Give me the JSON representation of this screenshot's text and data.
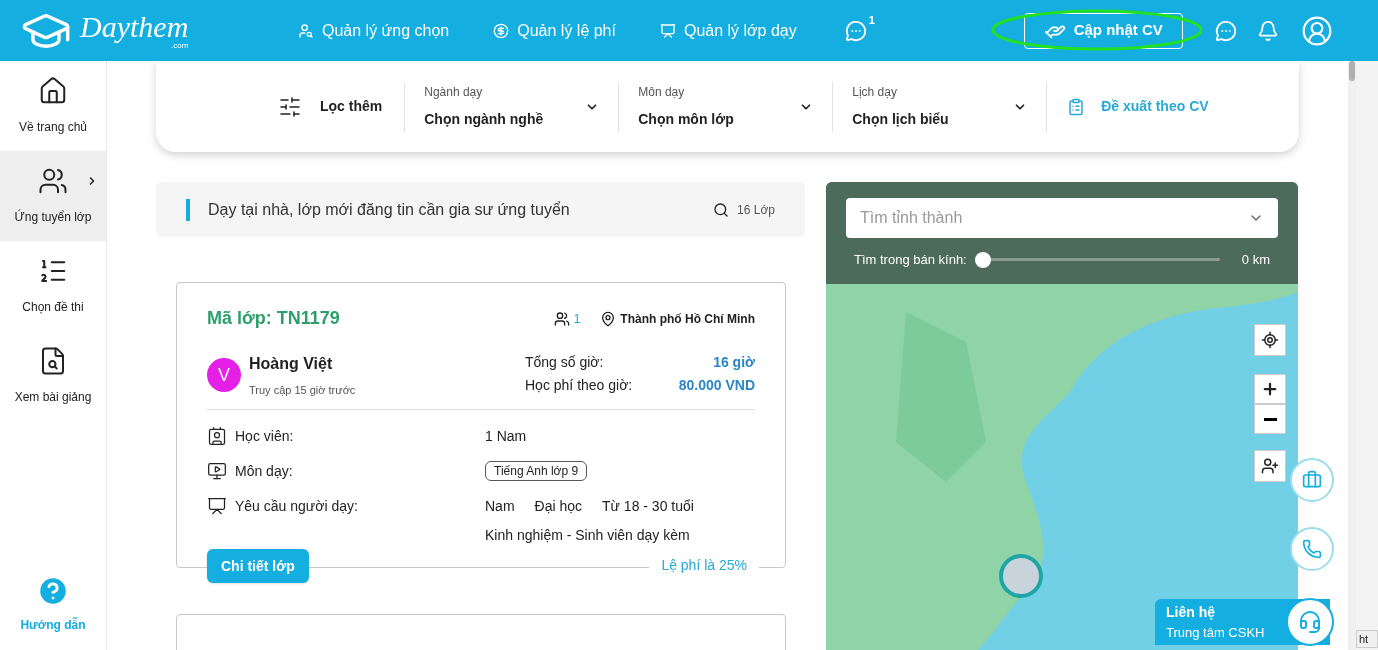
{
  "header": {
    "logo": {
      "name": "Daythem",
      "suffix": ".com"
    },
    "nav": [
      {
        "kind": "applicants",
        "label": "Quản lý ứng chọn"
      },
      {
        "kind": "fees",
        "label": "Quản lý lệ phí"
      },
      {
        "kind": "classes",
        "label": "Quản lý lớp dạy"
      }
    ],
    "more_badge": "1",
    "cv_button": "Cập nhật CV"
  },
  "sidebar": {
    "items": [
      {
        "kind": "home",
        "label": "Về trang chủ",
        "selected": false
      },
      {
        "kind": "apply",
        "label": "Ứng tuyển lớp",
        "selected": true
      },
      {
        "kind": "exam",
        "label": "Chọn đề thi",
        "selected": false
      },
      {
        "kind": "lectures",
        "label": "Xem bài giảng",
        "selected": false
      }
    ],
    "help": "Hướng dẫn"
  },
  "filters": {
    "more": "Lọc thêm",
    "dropdowns": [
      {
        "label": "Ngành dạy",
        "value": "Chọn ngành nghề"
      },
      {
        "label": "Môn dạy",
        "value": "Chọn môn lớp"
      },
      {
        "label": "Lịch dạy",
        "value": "Chọn lịch biểu"
      }
    ],
    "suggest": "Đề xuất theo CV"
  },
  "listing": {
    "title": "Dạy tại nhà, lớp mới đăng tin cần gia sư ứng tuyển",
    "count": "16 Lớp"
  },
  "card": {
    "code": "Mã lớp: TN1179",
    "applicants": "1",
    "location": "Thành phố Hồ Chí Minh",
    "avatar": "V",
    "name": "Hoàng Việt",
    "last_seen": "Truy cập 15 giờ trước",
    "stats": [
      {
        "label": "Tổng số giờ:",
        "value": "16 giờ"
      },
      {
        "label": "Học phí theo giờ:",
        "value": "80.000 VND"
      }
    ],
    "details": [
      {
        "kind": "students",
        "label": "Học viên:",
        "value": "1 Nam"
      },
      {
        "kind": "subject",
        "label": "Môn dạy:",
        "tag": "Tiếng Anh lớp 9"
      },
      {
        "kind": "requirements",
        "label": "Yêu cầu người dạy:",
        "values": [
          "Nam",
          "Đại học",
          "Từ 18 - 30 tuổi"
        ],
        "note": "Kinh nghiệm - Sinh viên dạy kèm"
      }
    ],
    "button": "Chi tiết lớp",
    "fee": "Lệ phí là 25%"
  },
  "map": {
    "placeholder": "Tìm tỉnh thành",
    "radius_label": "Tìm trong bán kính:",
    "radius": {
      "level": 0
    },
    "radius_value": "0 km"
  },
  "contact": {
    "title": "Liên hệ",
    "subtitle": "Trung tâm CSKH"
  },
  "side_tooltip": "ht"
}
